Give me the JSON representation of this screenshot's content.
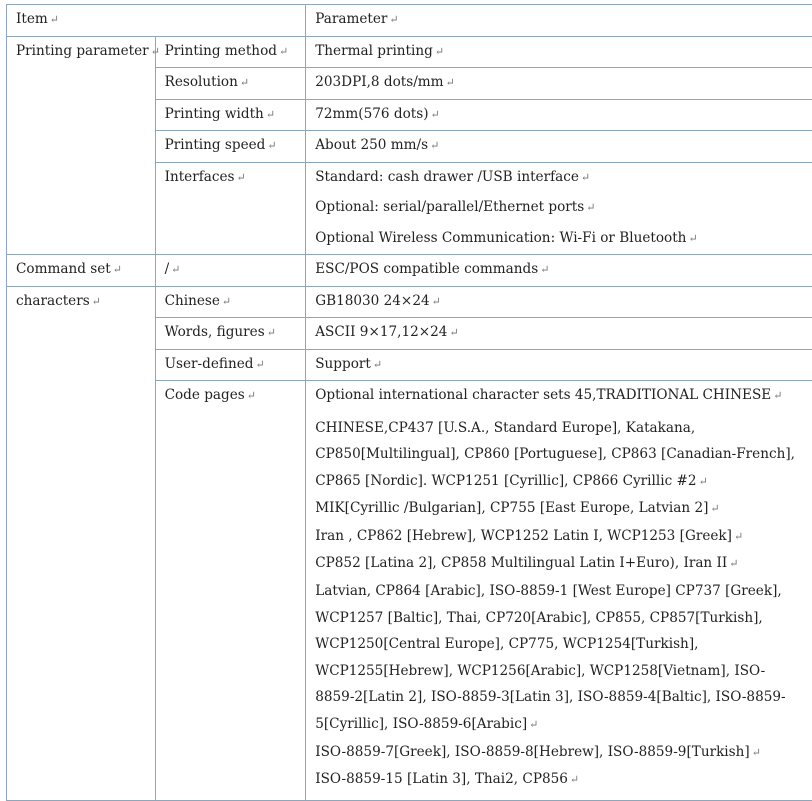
{
  "header": {
    "item": "Item",
    "parameter": "Parameter"
  },
  "mark": "↵",
  "printing": {
    "group": "Printing parameter",
    "rows": [
      {
        "label": "Printing method",
        "value": "Thermal printing"
      },
      {
        "label": "Resolution",
        "value": "203DPI,8 dots/mm"
      },
      {
        "label": "Printing width",
        "value": "72mm(576 dots)"
      },
      {
        "label": "Printing speed",
        "value": "About 250 mm/s"
      }
    ],
    "interfaces": {
      "label": "Interfaces",
      "lines": [
        "Standard: cash drawer /USB interface",
        "Optional: serial/parallel/Ethernet ports",
        "Optional Wireless Communication: Wi-Fi or Bluetooth"
      ]
    }
  },
  "command_set": {
    "group": "Command set",
    "label": "/",
    "value": "ESC/POS compatible commands"
  },
  "characters": {
    "group": "characters",
    "rows": [
      {
        "label": "Chinese",
        "value": "GB18030 24×24"
      },
      {
        "label": "Words, figures",
        "value": "ASCII 9×17,12×24"
      },
      {
        "label": "User-defined",
        "value": "Support"
      }
    ],
    "code_pages": {
      "label": "Code pages",
      "lines": [
        "Optional international character sets 45,TRADITIONAL CHINESE",
        "CHINESE,CP437 [U.S.A., Standard Europe], Katakana,",
        "CP850[Multilingual], CP860 [Portuguese], CP863 [Canadian-French],",
        "CP865 [Nordic]. WCP1251 [Cyrillic], CP866 Cyrillic #2",
        "MIK[Cyrillic /Bulgarian], CP755 [East Europe, Latvian 2]",
        "Iran , CP862 [Hebrew], WCP1252 Latin I, WCP1253 [Greek]",
        "CP852 [Latina 2], CP858 Multilingual Latin Ⅰ+Euro), Iran II",
        "Latvian, CP864 [Arabic], ISO-8859-1 [West Europe] CP737 [Greek],",
        "WCP1257 [Baltic], Thai, CP720[Arabic], CP855, CP857[Turkish],",
        "WCP1250[Central Europe], CP775, WCP1254[Turkish],",
        "WCP1255[Hebrew], WCP1256[Arabic], WCP1258[Vietnam], ISO-",
        "8859-2[Latin 2], ISO-8859-3[Latin 3], ISO-8859-4[Baltic], ISO-8859-",
        "5[Cyrillic], ISO-8859-6[Arabic]",
        "ISO-8859-7[Greek], ISO-8859-8[Hebrew], ISO-8859-9[Turkish]",
        "ISO-8859-15 [Latin 3], Thai2, CP856"
      ]
    }
  }
}
